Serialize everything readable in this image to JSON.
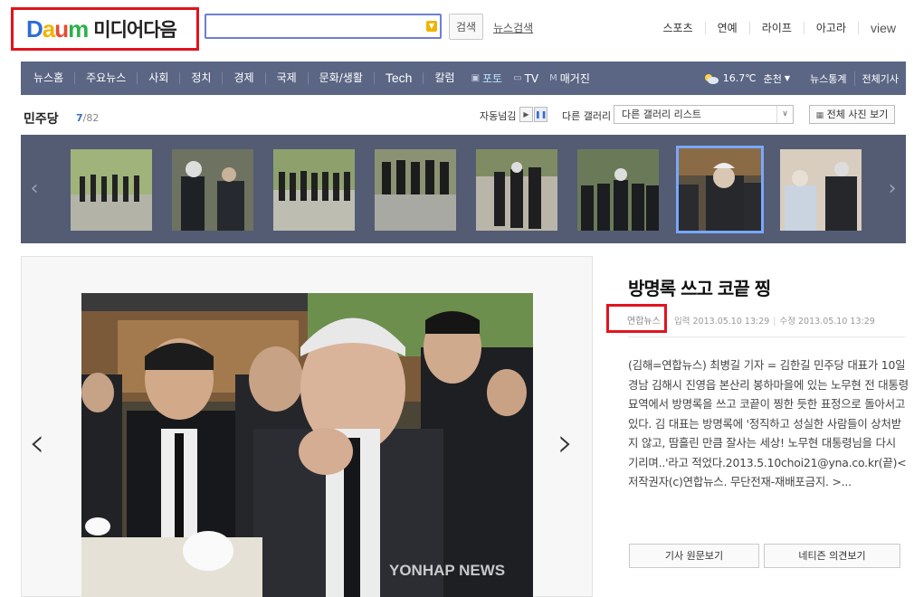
{
  "header": {
    "logo_text": "Daum",
    "logo_subtitle": "미디어다음",
    "search_placeholder": "",
    "search_button": "검색",
    "news_search_link": "뉴스검색",
    "top_links": [
      "스포츠",
      "연예",
      "라이프",
      "아고라",
      "view"
    ]
  },
  "gnb": {
    "items": [
      "뉴스홈",
      "주요뉴스",
      "사회",
      "정치",
      "경제",
      "국제",
      "문화/생활",
      "Tech",
      "칼럼"
    ],
    "media": [
      {
        "icon": "camera-icon",
        "label": "포토",
        "active": true
      },
      {
        "icon": "tv-icon",
        "label": "TV",
        "active": false
      },
      {
        "icon": "magazine-icon",
        "label": "매거진",
        "active": false
      }
    ],
    "weather": {
      "temp": "16.7℃",
      "city": "춘천",
      "icon": "partly-cloudy-icon"
    },
    "right_links": [
      "뉴스통계",
      "전체기사"
    ]
  },
  "gallery": {
    "section_title": "민주당",
    "current": "7",
    "total": "/82",
    "autoplay_label": "자동넘김",
    "other_gallery_label": "다른 갤러리",
    "select_value": "다른 갤러리 리스트",
    "view_all_button": "전체 사진 보기",
    "thumbnails": 8,
    "active_index": 6
  },
  "article": {
    "title": "방명록 쓰고 코끝 찡",
    "source": "연합뉴스",
    "input_time": "입력 2013.05.10 13:29",
    "modified_time": "수정 2013.05.10 13:29",
    "body": "(김해=연합뉴스) 최병길 기자 = 김한길 민주당 대표가 10일 경남 김해시 진영읍 본산리 봉하마을에 있는 노무현 전 대통령 묘역에서 방명록을 쓰고 코끝이 찡한 듯한 표정으로 돌아서고 있다. 김 대표는 방명록에 '정직하고 성실한 사람들이 상처받지 않고, 땀흘린 만큼 잘사는 세상! 노무현 대통령님을 다시 기리며..'라고 적었다.2013.5.10choi21@yna.co.kr(끝)< 저작권자(c)연합뉴스. 무단전재-재배포금지. >...",
    "original_button": "기사 원문보기",
    "comments_button": "네티즌 의견보기",
    "watermark": "YONHAP NEWS"
  },
  "colors": {
    "gnb_bg": "#5b6684",
    "strip_bg": "#535c73",
    "highlight": "#e0141e",
    "active_thumb": "#78a8ff"
  }
}
